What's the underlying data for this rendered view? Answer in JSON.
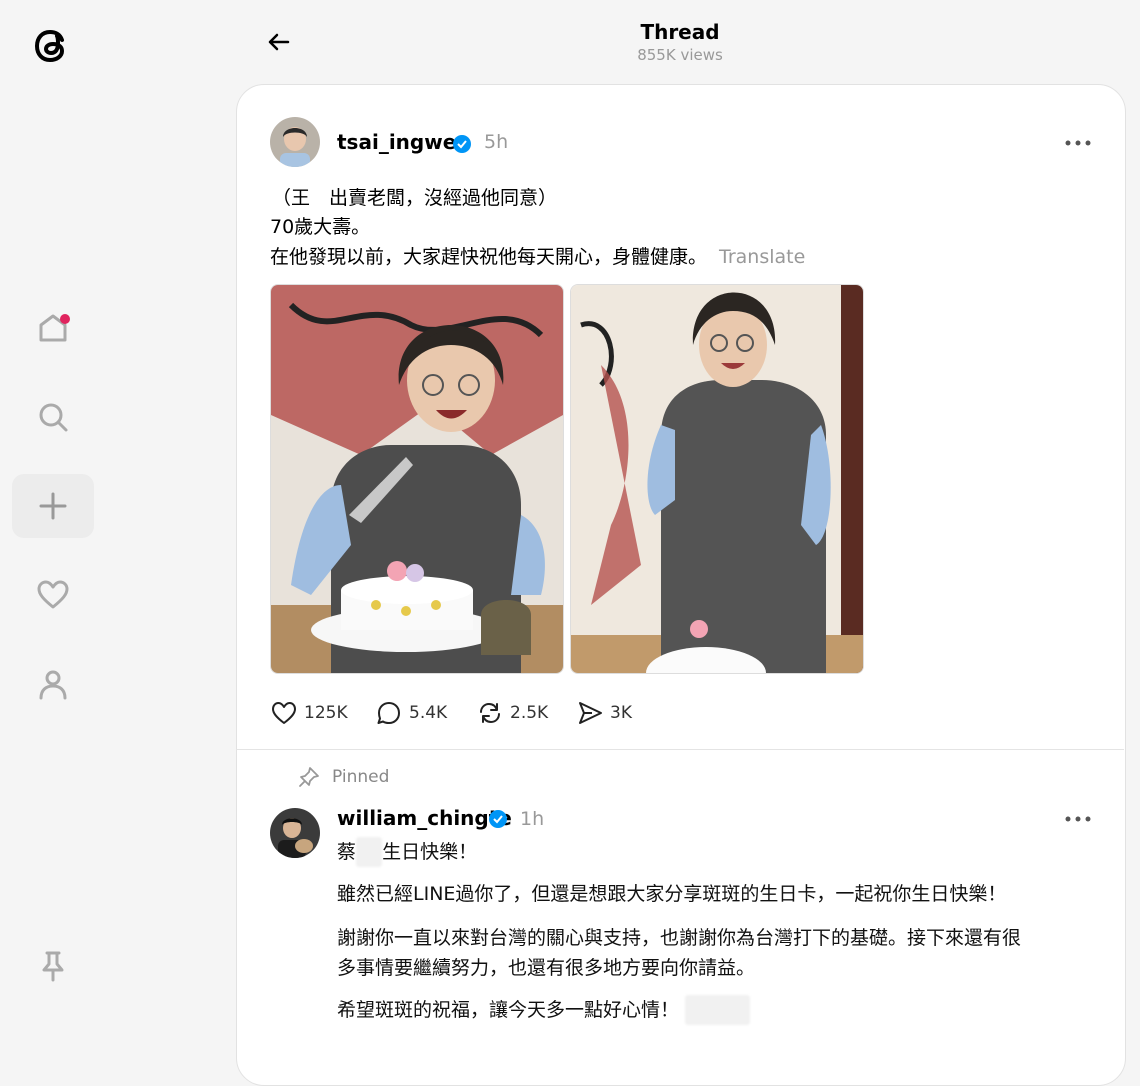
{
  "header": {
    "title": "Thread",
    "views": "855K views"
  },
  "post": {
    "username": "tsai_ingwen",
    "time": "5h",
    "lines": [
      "（王　出賣老闆，沒經過他同意）",
      "70歲大壽。",
      "在他發現以前，大家趕快祝他每天開心，身體健康。"
    ],
    "translate_label": "Translate",
    "actions": {
      "likes": "125K",
      "replies": "5.4K",
      "reposts": "2.5K",
      "shares": "3K"
    }
  },
  "reply": {
    "pinned_label": "Pinned",
    "username": "william_chingte",
    "time": "1h",
    "greeting_a": "蔡",
    "greeting_b": "生日快樂！",
    "p1": "雖然已經LINE過你了，但還是想跟大家分享斑斑的生日卡，一起祝你生日快樂！",
    "p2a": "謝謝你一直以來對台灣的關心與支持，也謝謝你為台灣打下的基礎。接下來還有很",
    "p2b": "多事情要繼續努力，也還有很多地方要向你請益。",
    "p3": "希望斑斑的祝福，讓今天多一點好心情！"
  },
  "colors": {
    "verified": "#0095f6",
    "notification_dot": "#e0245e",
    "muted": "#999999"
  },
  "icons": [
    "threads-logo",
    "home-icon",
    "search-icon",
    "plus-icon",
    "heart-icon",
    "profile-icon",
    "pin-icon",
    "back-arrow-icon",
    "more-icon",
    "verified-icon",
    "like-icon",
    "comment-icon",
    "repost-icon",
    "share-icon"
  ]
}
